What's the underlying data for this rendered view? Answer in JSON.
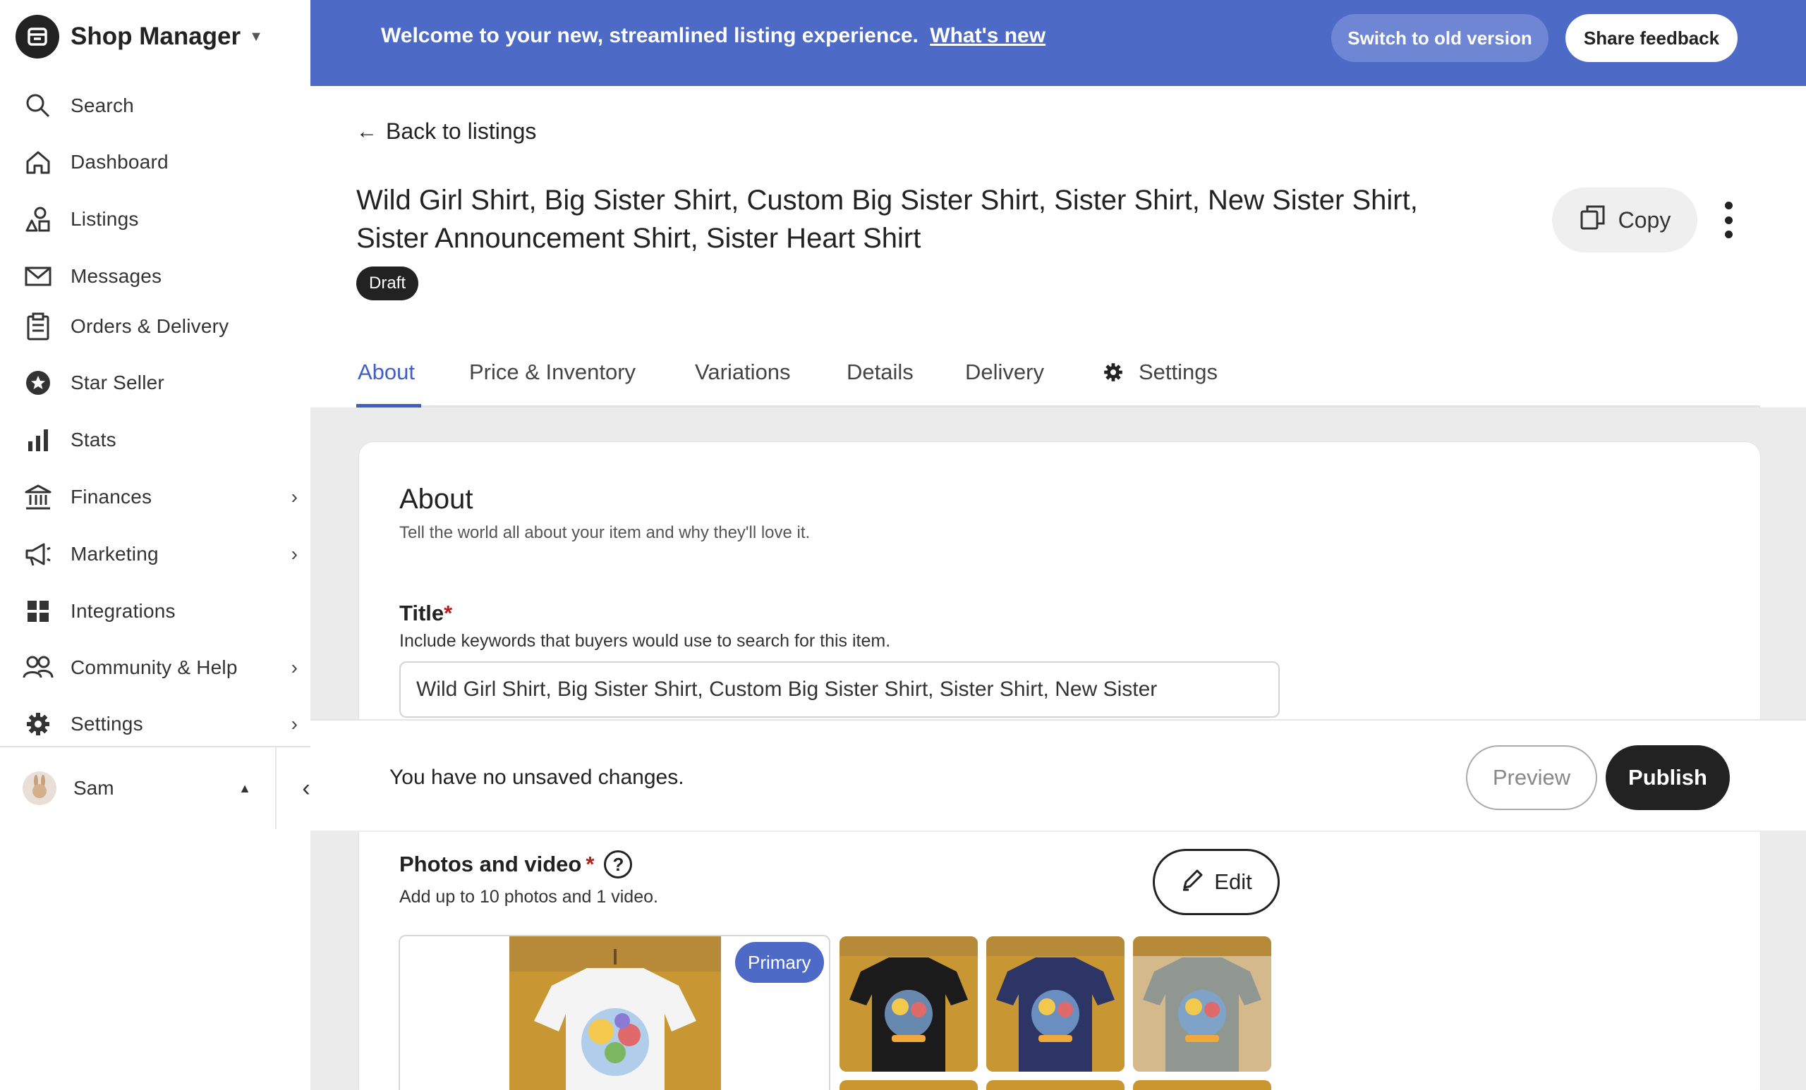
{
  "app": {
    "name": "Shop Manager"
  },
  "nav": {
    "items": [
      {
        "label": "Search",
        "icon": "search-icon"
      },
      {
        "label": "Dashboard",
        "icon": "home-icon"
      },
      {
        "label": "Listings",
        "icon": "shapes-icon"
      },
      {
        "label": "Messages",
        "icon": "envelope-icon"
      },
      {
        "label": "Orders & Delivery",
        "icon": "clipboard-icon"
      },
      {
        "label": "Star Seller",
        "icon": "star-badge-icon"
      },
      {
        "label": "Stats",
        "icon": "bar-chart-icon"
      },
      {
        "label": "Finances",
        "icon": "bank-icon",
        "has_submenu": true
      },
      {
        "label": "Marketing",
        "icon": "megaphone-icon",
        "has_submenu": true
      },
      {
        "label": "Integrations",
        "icon": "grid-icon"
      },
      {
        "label": "Community & Help",
        "icon": "people-icon",
        "has_submenu": true
      },
      {
        "label": "Settings",
        "icon": "gear-icon",
        "has_submenu": true
      }
    ]
  },
  "user": {
    "name": "Sam"
  },
  "banner": {
    "text": "Welcome to your new, streamlined listing experience.",
    "link": "What's new",
    "switch_label": "Switch to old version",
    "feedback_label": "Share feedback",
    "color": "#4e6ac7"
  },
  "listing": {
    "back_label": "Back to listings",
    "title": "Wild Girl Shirt, Big Sister Shirt, Custom Big Sister Shirt, Sister Shirt, New Sister Shirt, Sister Announcement Shirt, Sister Heart Shirt",
    "status": "Draft",
    "copy_label": "Copy"
  },
  "tabs": [
    {
      "label": "About",
      "active": true
    },
    {
      "label": "Price & Inventory"
    },
    {
      "label": "Variations"
    },
    {
      "label": "Details"
    },
    {
      "label": "Delivery"
    },
    {
      "label": "Settings",
      "icon": "gear-icon"
    }
  ],
  "about": {
    "heading": "About",
    "subheading": "Tell the world all about your item and why they'll love it.",
    "title_field": {
      "label": "Title",
      "required_mark": "*",
      "help": "Include keywords that buyers would use to search for this item.",
      "value": "Wild Girl Shirt, Big Sister Shirt, Custom Big Sister Shirt, Sister Shirt, New Sister"
    }
  },
  "save_bar": {
    "message": "You have no unsaved changes.",
    "preview_label": "Preview",
    "publish_label": "Publish"
  },
  "photos": {
    "label": "Photos and video",
    "required_mark": "*",
    "help_icon": "?",
    "help": "Add up to 10 photos and 1 video.",
    "edit_label": "Edit",
    "primary_badge": "Primary",
    "thumbnails": [
      {
        "shirt_color": "#f4f4f4"
      },
      {
        "shirt_color": "#1b1b1b"
      },
      {
        "shirt_color": "#2c3566"
      },
      {
        "shirt_color": "#8f9790"
      }
    ]
  },
  "colors": {
    "accent": "#3f5fc6",
    "primary_button": "#222222",
    "required": "#b2201f"
  }
}
